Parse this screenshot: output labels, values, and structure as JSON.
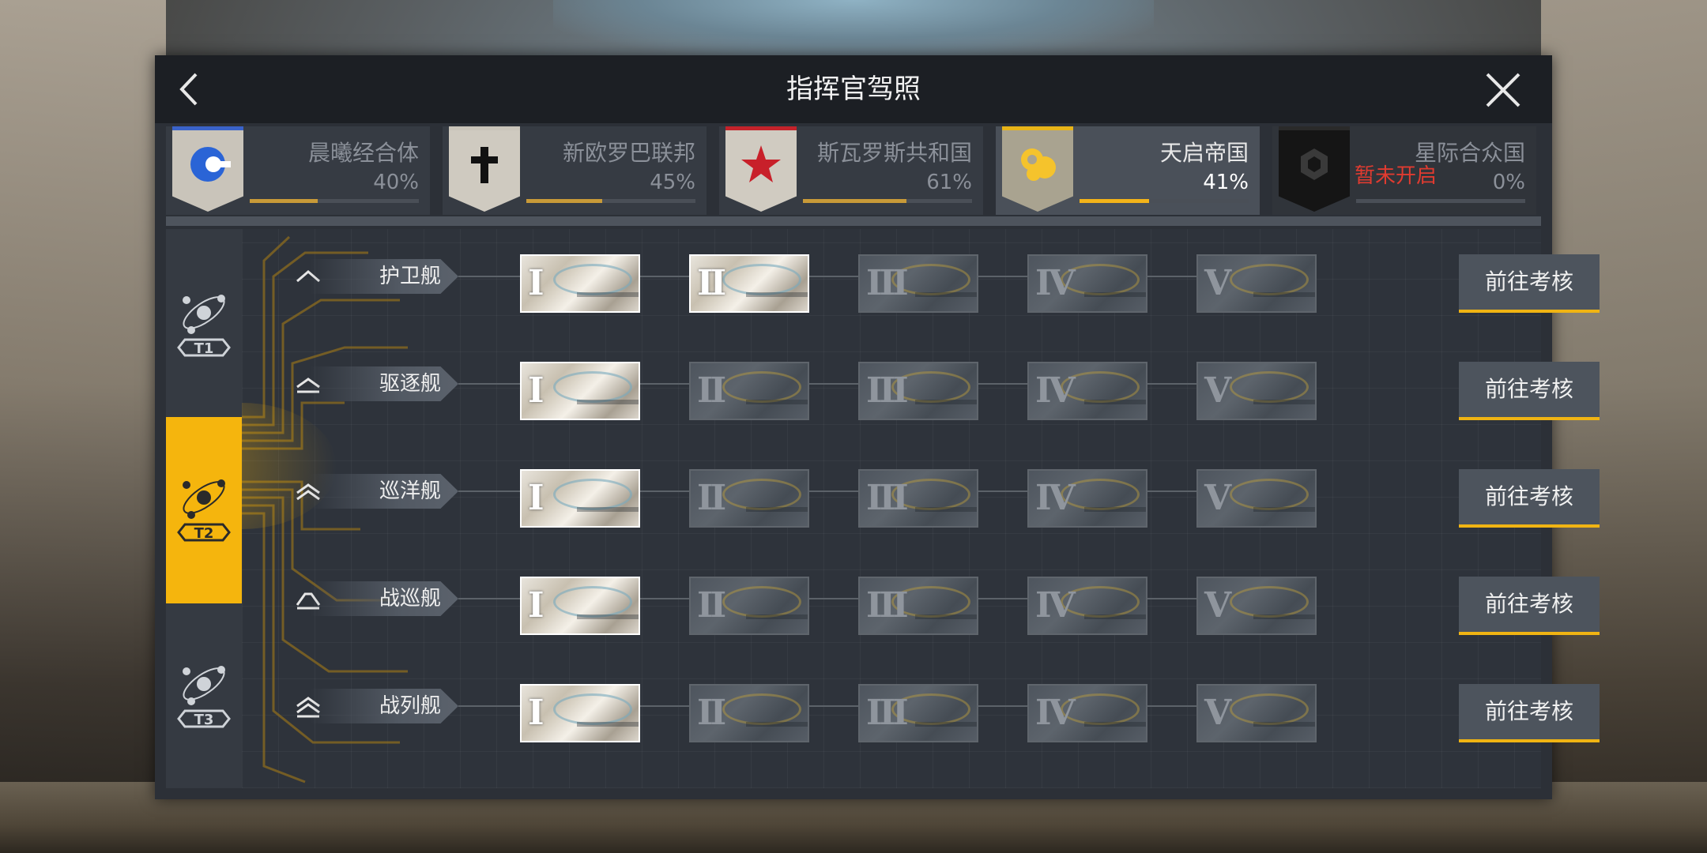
{
  "header": {
    "title": "指挥官驾照"
  },
  "factions": [
    {
      "name": "晨曦经合体",
      "pct": "40%",
      "progress": 0.4,
      "accent": "#3a63c9",
      "active": false,
      "locked": false
    },
    {
      "name": "新欧罗巴联邦",
      "pct": "45%",
      "progress": 0.45,
      "accent": "#c9c4ba",
      "active": false,
      "locked": false
    },
    {
      "name": "斯瓦罗斯共和国",
      "pct": "61%",
      "progress": 0.61,
      "accent": "#c4232b",
      "active": false,
      "locked": false
    },
    {
      "name": "天启帝国",
      "pct": "41%",
      "progress": 0.41,
      "accent": "#e8b418",
      "active": true,
      "locked": false
    },
    {
      "name": "星际合众国",
      "pct": "0%",
      "progress": 0.0,
      "accent": "#2a2a2a",
      "active": false,
      "locked": true,
      "locked_text": "暂未开启"
    }
  ],
  "tiers": [
    {
      "label": "T1",
      "active": false
    },
    {
      "label": "T2",
      "active": true
    },
    {
      "label": "T3",
      "active": false
    }
  ],
  "ship_rows": [
    {
      "label": "护卫舰",
      "rank_icon": "single-chevron",
      "unlocked": 2
    },
    {
      "label": "驱逐舰",
      "rank_icon": "single-bar-chevron",
      "unlocked": 1
    },
    {
      "label": "巡洋舰",
      "rank_icon": "double-chevron",
      "unlocked": 1
    },
    {
      "label": "战巡舰",
      "rank_icon": "bar-chevron",
      "unlocked": 1
    },
    {
      "label": "战列舰",
      "rank_icon": "double-bar-chevron",
      "unlocked": 1
    }
  ],
  "levels": [
    "I",
    "II",
    "III",
    "IV",
    "V"
  ],
  "action_label": "前往考核",
  "colors": {
    "accent": "#f5b50d",
    "locked_text": "#e03b30"
  }
}
